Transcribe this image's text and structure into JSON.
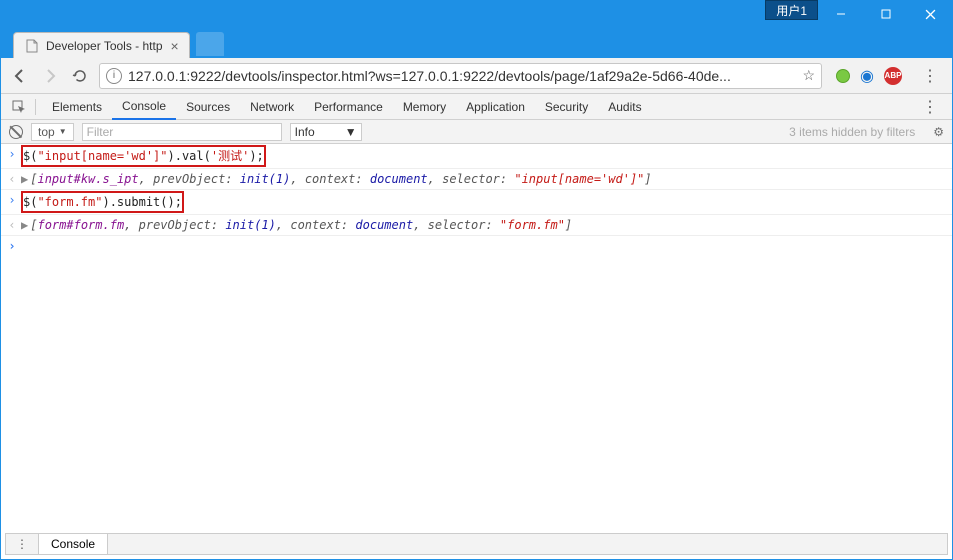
{
  "window": {
    "user_badge": "用户1"
  },
  "tab": {
    "title": "Developer Tools - http"
  },
  "omnibox": {
    "url": "127.0.0.1:9222/devtools/inspector.html?ws=127.0.0.1:9222/devtools/page/1af29a2e-5d66-40de..."
  },
  "extensions": {
    "abp_label": "ABP"
  },
  "devtools": {
    "tabs": [
      "Elements",
      "Console",
      "Sources",
      "Network",
      "Performance",
      "Memory",
      "Application",
      "Security",
      "Audits"
    ],
    "active_tab_index": 1
  },
  "console_toolbar": {
    "context": "top",
    "filter_placeholder": "Filter",
    "level": "Info",
    "hidden_msg": "3 items hidden by filters"
  },
  "console": {
    "lines": [
      {
        "kind": "input",
        "boxed": true,
        "tokens": [
          {
            "t": "$(",
            "c": "c-black"
          },
          {
            "t": "\"input[name='wd']\"",
            "c": "c-str"
          },
          {
            "t": ").val(",
            "c": "c-black"
          },
          {
            "t": "'测试'",
            "c": "c-str"
          },
          {
            "t": ");",
            "c": "c-black"
          }
        ]
      },
      {
        "kind": "output",
        "tokens": [
          {
            "t": "[",
            "c": "c-out-key"
          },
          {
            "t": "input#kw.s_ipt",
            "c": "c-out-expr"
          },
          {
            "t": ", ",
            "c": "c-out-key"
          },
          {
            "t": "prevObject: ",
            "c": "c-out-key"
          },
          {
            "t": "init(1)",
            "c": "c-out-val"
          },
          {
            "t": ", ",
            "c": "c-out-key"
          },
          {
            "t": "context: ",
            "c": "c-out-key"
          },
          {
            "t": "document",
            "c": "c-out-val"
          },
          {
            "t": ", ",
            "c": "c-out-key"
          },
          {
            "t": "selector: ",
            "c": "c-out-key"
          },
          {
            "t": "\"input[name='wd']\"",
            "c": "c-out-str"
          },
          {
            "t": "]",
            "c": "c-out-key"
          }
        ]
      },
      {
        "kind": "input",
        "boxed": true,
        "tokens": [
          {
            "t": "$(",
            "c": "c-black"
          },
          {
            "t": "\"form.fm\"",
            "c": "c-str"
          },
          {
            "t": ").submit();",
            "c": "c-black"
          }
        ]
      },
      {
        "kind": "output",
        "tokens": [
          {
            "t": "[",
            "c": "c-out-key"
          },
          {
            "t": "form#form.fm",
            "c": "c-out-expr"
          },
          {
            "t": ", ",
            "c": "c-out-key"
          },
          {
            "t": "prevObject: ",
            "c": "c-out-key"
          },
          {
            "t": "init(1)",
            "c": "c-out-val"
          },
          {
            "t": ", ",
            "c": "c-out-key"
          },
          {
            "t": "context: ",
            "c": "c-out-key"
          },
          {
            "t": "document",
            "c": "c-out-val"
          },
          {
            "t": ", ",
            "c": "c-out-key"
          },
          {
            "t": "selector: ",
            "c": "c-out-key"
          },
          {
            "t": "\"form.fm\"",
            "c": "c-out-str"
          },
          {
            "t": "]",
            "c": "c-out-key"
          }
        ]
      }
    ]
  },
  "drawer": {
    "tab": "Console"
  }
}
